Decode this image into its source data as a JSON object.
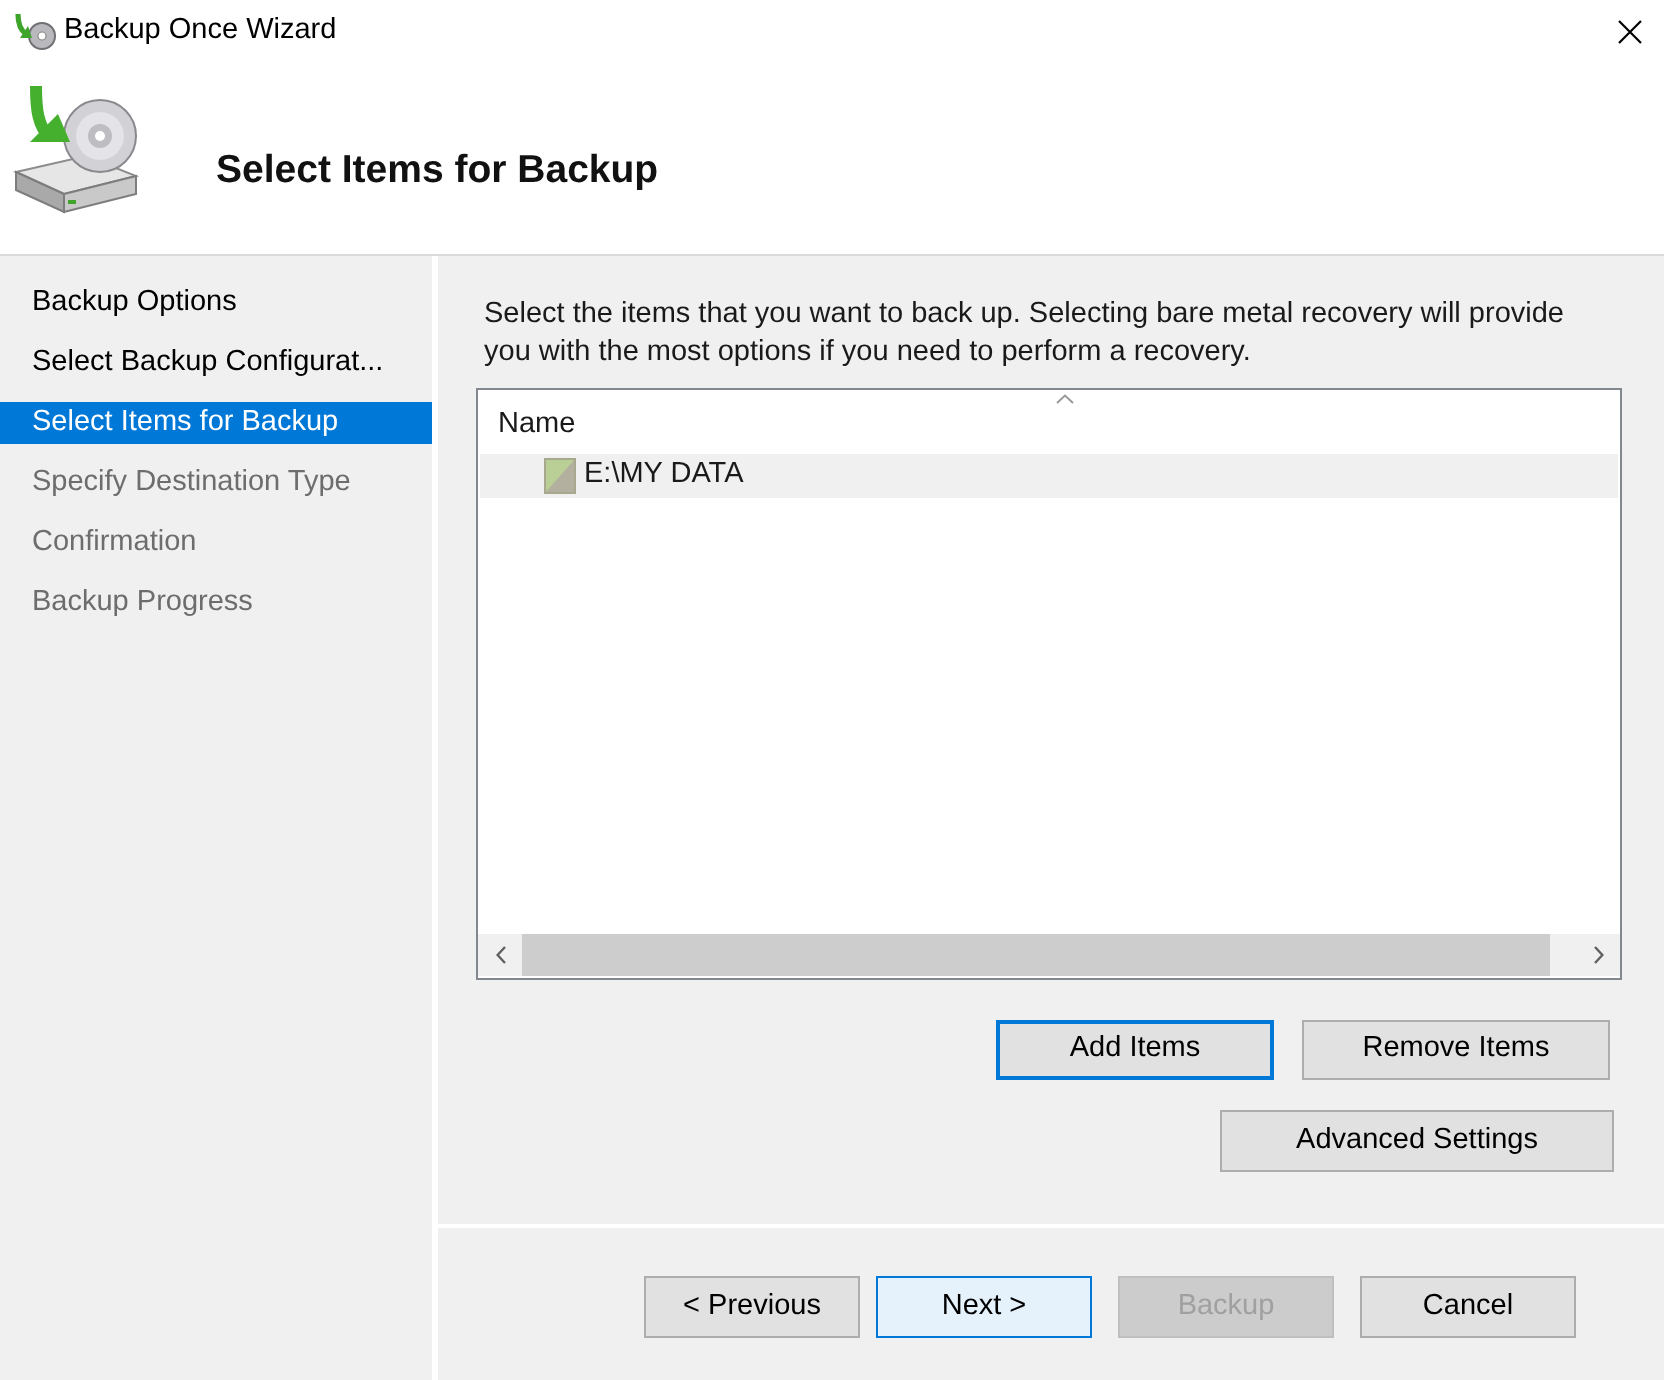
{
  "window": {
    "title": "Backup Once Wizard"
  },
  "header": {
    "title": "Select Items for Backup"
  },
  "steps": [
    {
      "label": "Backup Options",
      "selected": false,
      "disabled": false
    },
    {
      "label": "Select Backup Configurat...",
      "selected": false,
      "disabled": false
    },
    {
      "label": "Select Items for Backup",
      "selected": true,
      "disabled": false
    },
    {
      "label": "Specify Destination Type",
      "selected": false,
      "disabled": true
    },
    {
      "label": "Confirmation",
      "selected": false,
      "disabled": true
    },
    {
      "label": "Backup Progress",
      "selected": false,
      "disabled": true
    }
  ],
  "instructions": "Select the items that you want to back up. Selecting bare metal recovery will provide you with the most options if you need to perform a recovery.",
  "item_list": {
    "columns": [
      {
        "label": "Name",
        "sorted": true
      }
    ],
    "rows": [
      {
        "name": "E:\\MY DATA",
        "selected": true
      }
    ]
  },
  "list_buttons": [
    {
      "label": "Add Items",
      "focused": true,
      "hovered": false,
      "disabled": false
    },
    {
      "label": "Remove Items",
      "focused": false,
      "hovered": false,
      "disabled": false
    },
    {
      "label": "Advanced Settings",
      "focused": false,
      "hovered": false,
      "disabled": false
    }
  ],
  "nav_buttons": [
    {
      "label": "< Previous",
      "focused": false,
      "hovered": false,
      "disabled": false
    },
    {
      "label": "Next >",
      "focused": false,
      "hovered": true,
      "disabled": false
    }
  ],
  "action_buttons": [
    {
      "label": "Backup",
      "focused": false,
      "hovered": false,
      "disabled": true
    },
    {
      "label": "Cancel",
      "focused": false,
      "hovered": false,
      "disabled": false
    }
  ]
}
